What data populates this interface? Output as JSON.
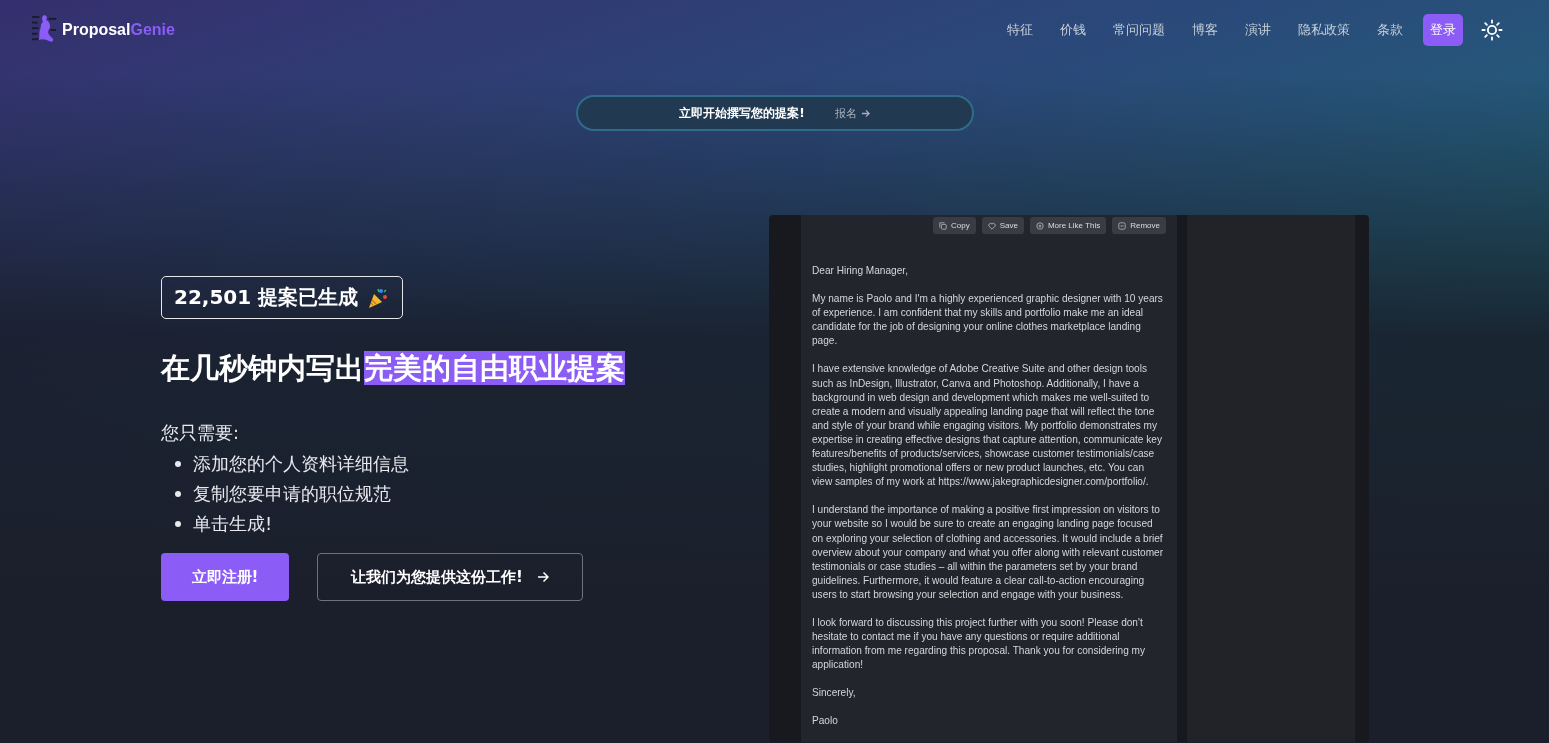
{
  "brand": {
    "name_part_1": "Proposal",
    "name_part_2": "Genie"
  },
  "nav": {
    "links": [
      "特征",
      "价钱",
      "常问问题",
      "博客",
      "演讲",
      "隐私政策",
      "条款"
    ],
    "login": "登录"
  },
  "announcement": {
    "text": "立即开始撰写您的提案!",
    "link": "报名"
  },
  "hero": {
    "badge": "22,501 提案已生成",
    "title_lead": "在几秒钟内写出",
    "title_highlight": "完美的自由职业提案",
    "intro": "您只需要:",
    "steps": [
      "添加您的个人资料详细信息",
      "复制您要申请的职位规范",
      "单击生成!"
    ],
    "primary_button": "立即注册!",
    "secondary_button": "让我们为您提供这份工作!"
  },
  "preview": {
    "actions": [
      {
        "kind": "copy",
        "label": "Copy"
      },
      {
        "kind": "save",
        "label": "Save"
      },
      {
        "kind": "more",
        "label": "More Like This"
      },
      {
        "kind": "remove",
        "label": "Remove"
      }
    ],
    "paragraphs": [
      "Dear Hiring Manager,",
      "My name is Paolo and I'm a highly experienced graphic designer with 10 years of experience. I am confident that my skills and portfolio make me an ideal candidate for the job of designing your online clothes marketplace landing page.",
      "I have extensive knowledge of Adobe Creative Suite and other design tools such as InDesign, Illustrator, Canva and Photoshop. Additionally, I have a background in web design and development which makes me well-suited to create a modern and visually appealing landing page that will reflect the tone and style of your brand while engaging visitors. My portfolio demonstrates my expertise in creating effective designs that capture attention, communicate key features/benefits of products/services, showcase customer testimonials/case studies, highlight promotional offers or new product launches, etc. You can view samples of my work at https://www.jakegraphicdesigner.com/portfolio/.",
      "I understand the importance of making a positive first impression on visitors to your website so I would be sure to create an engaging landing page focused on exploring your selection of clothing and accessories. It would include a brief overview about your company and what you offer along with relevant customer testimonials or case studies – all within the parameters set by your brand guidelines. Furthermore, it would feature a clear call-to-action encouraging users to start browsing your selection and engage with your business.",
      "I look forward to discussing this project further with you soon! Please don't hesitate to contact me if you have any questions or require additional information from me regarding this proposal. Thank you for considering my application!",
      "Sincerely,",
      "Paolo"
    ]
  }
}
